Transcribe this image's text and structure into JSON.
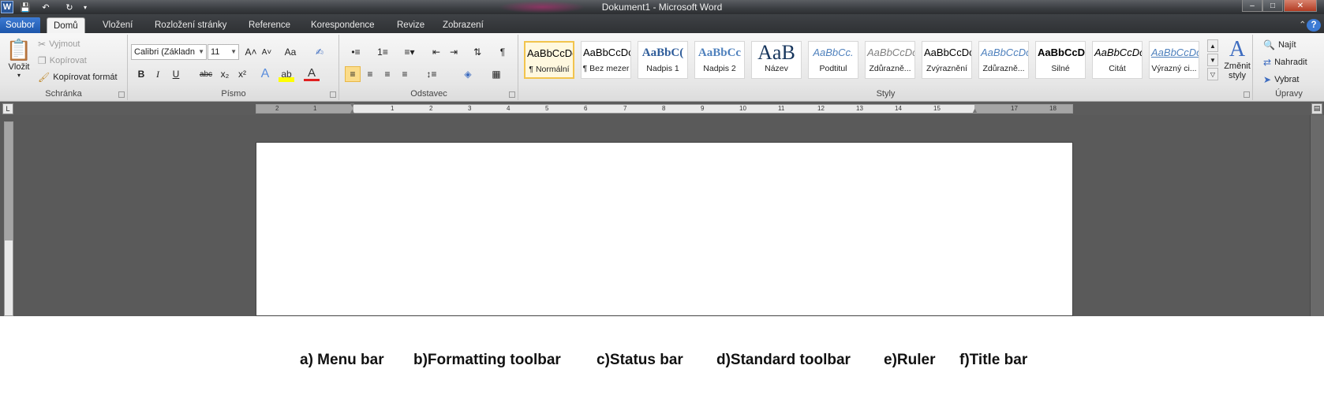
{
  "window": {
    "title": "Dokument1  -  Microsoft Word",
    "minimize": "–",
    "maximize": "□",
    "close": "✕"
  },
  "tabs": [
    {
      "label": "Soubor"
    },
    {
      "label": "Domů"
    },
    {
      "label": "Vložení"
    },
    {
      "label": "Rozložení stránky"
    },
    {
      "label": "Reference"
    },
    {
      "label": "Korespondence"
    },
    {
      "label": "Revize"
    },
    {
      "label": "Zobrazení"
    }
  ],
  "ribbon": {
    "clipboard": {
      "label": "Schránka",
      "paste": "Vložit",
      "cut": "Vyjmout",
      "copy": "Kopírovat",
      "format_painter": "Kopírovat formát"
    },
    "font": {
      "label": "Písmo",
      "font_name": "Calibri (Základn",
      "font_size": "11",
      "bold": "B",
      "italic": "I",
      "underline": "U",
      "strike": "abc",
      "subscript": "x₂",
      "superscript": "x²",
      "grow": "A˄",
      "shrink": "A˅",
      "case": "Aa"
    },
    "paragraph": {
      "label": "Odstavec"
    },
    "styles": {
      "label": "Styly",
      "items": [
        {
          "sample": "AaBbCcDc",
          "name": "¶ Normální",
          "color": "#000000"
        },
        {
          "sample": "AaBbCcDc",
          "name": "¶ Bez mezer",
          "color": "#000000"
        },
        {
          "sample": "AaBbC(",
          "name": "Nadpis 1",
          "color": "#2e5c9a"
        },
        {
          "sample": "AaBbCc",
          "name": "Nadpis 2",
          "color": "#4f81bd"
        },
        {
          "sample": "AaB",
          "name": "Název",
          "color": "#17365d"
        },
        {
          "sample": "AaBbCc.",
          "name": "Podtitul",
          "color": "#4f81bd"
        },
        {
          "sample": "AaBbCcDc",
          "name": "Zdůrazně...",
          "color": "#808080"
        },
        {
          "sample": "AaBbCcDc",
          "name": "Zvýraznění",
          "color": "#000000"
        },
        {
          "sample": "AaBbCcDc",
          "name": "Zdůrazně...",
          "color": "#4f81bd"
        },
        {
          "sample": "AaBbCcDc",
          "name": "Silné",
          "color": "#000000"
        },
        {
          "sample": "AaBbCcDc",
          "name": "Citát",
          "color": "#000000"
        },
        {
          "sample": "AaBbCcDc",
          "name": "Výrazný ci...",
          "color": "#4f81bd"
        }
      ],
      "change_styles_line1": "Změnit",
      "change_styles_line2": "styly"
    },
    "editing": {
      "label": "Úpravy",
      "find": "Najít",
      "replace": "Nahradit",
      "select": "Vybrat"
    }
  },
  "ruler": {
    "ticks": [
      "2",
      "1",
      "1",
      "2",
      "3",
      "4",
      "5",
      "6",
      "7",
      "8",
      "9",
      "10",
      "11",
      "12",
      "13",
      "14",
      "15",
      "17",
      "18"
    ]
  },
  "caption": {
    "a": "a) Menu bar",
    "b": "b)Formatting toolbar",
    "c": "c)Status bar",
    "d": "d)Standard toolbar",
    "e": "e)Ruler",
    "f": "f)Title bar"
  }
}
